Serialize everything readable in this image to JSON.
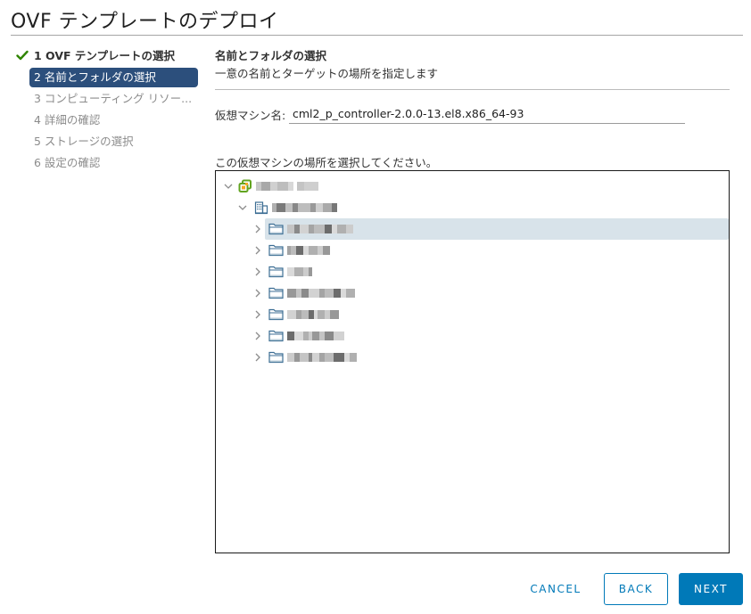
{
  "window": {
    "title": "OVF テンプレートのデプロイ"
  },
  "steps": [
    {
      "label": "1 OVF テンプレートの選択",
      "state": "done"
    },
    {
      "label": "2 名前とフォルダの選択",
      "state": "active"
    },
    {
      "label": "3 コンピューティング リソー...",
      "state": "pending"
    },
    {
      "label": "4 詳細の確認",
      "state": "pending"
    },
    {
      "label": "5 ストレージの選択",
      "state": "pending"
    },
    {
      "label": "6 設定の確認",
      "state": "pending"
    }
  ],
  "main": {
    "section_title": "名前とフォルダの選択",
    "section_subtitle": "一意の名前とターゲットの場所を指定します",
    "vm_name_label": "仮想マシン名:",
    "vm_name_value": "cml2_p_controller-2.0.0-13.el8.x86_64-93",
    "location_label": "この仮想マシンの場所を選択してください。"
  },
  "tree": {
    "nodes": [
      {
        "type": "vcenter",
        "icon": "vcenter-icon",
        "label": "[redacted]",
        "expanded": true,
        "level": 0
      },
      {
        "type": "datacenter",
        "icon": "datacenter-icon",
        "label": "[redacted]",
        "expanded": true,
        "level": 1
      },
      {
        "type": "folder",
        "icon": "folder-icon",
        "label": "[redacted]",
        "expanded": false,
        "level": 2,
        "selected": true
      },
      {
        "type": "folder",
        "icon": "folder-icon",
        "label": "[redacted]",
        "expanded": false,
        "level": 2
      },
      {
        "type": "folder",
        "icon": "folder-icon",
        "label": "[redacted]",
        "expanded": false,
        "level": 2
      },
      {
        "type": "folder",
        "icon": "folder-icon",
        "label": "[redacted]",
        "expanded": false,
        "level": 2
      },
      {
        "type": "folder",
        "icon": "folder-icon",
        "label": "[redacted]",
        "expanded": false,
        "level": 2
      },
      {
        "type": "folder",
        "icon": "folder-icon",
        "label": "[redacted]",
        "expanded": false,
        "level": 2
      },
      {
        "type": "folder",
        "icon": "folder-icon",
        "label": "[redacted]",
        "expanded": false,
        "level": 2
      }
    ]
  },
  "footer": {
    "cancel_label": "CANCEL",
    "back_label": "BACK",
    "next_label": "NEXT"
  },
  "colors": {
    "accent": "#0079b8",
    "active_step_bg": "#2c4f7c",
    "selected_row_bg": "#d8e3ea",
    "check_green": "#2f8400"
  }
}
